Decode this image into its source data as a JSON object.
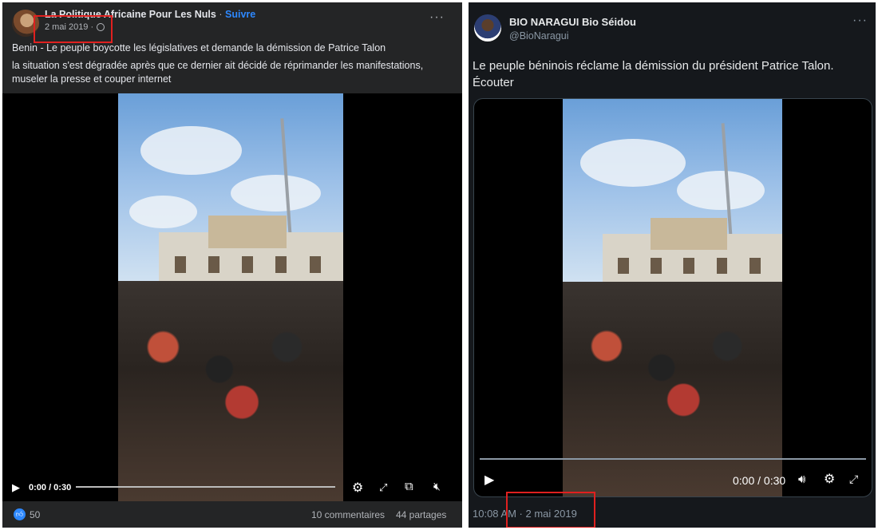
{
  "facebook": {
    "page_name": "La Politique Africaine Pour Les Nuls",
    "separator": "·",
    "follow_label": "Suivre",
    "date": "2 mai 2019 ·",
    "more_label": "···",
    "post_line1": "Benin - Le peuple boycotte les législatives et demande la démission de Patrice Talon",
    "post_line2": "la situation s'est dégradée après que ce dernier ait décidé de réprimander les manifestations, museler la presse et couper internet",
    "video_time": "0:00 / 0:30",
    "video_progress": 0,
    "reactions_count": "50",
    "comments": "10 commentaires",
    "shares": "44 partages"
  },
  "twitter": {
    "display_name": "BIO NARAGUI Bio Séidou",
    "handle": "@BioNaragui",
    "more_label": "···",
    "tweet_text": "Le peuple béninois réclame la démission du président Patrice Talon. Écouter",
    "video_time": "0:00 / 0:30",
    "video_progress": 0,
    "timestamp": "10:08 AM · 2 mai 2019"
  },
  "colors": {
    "highlight_box": "#e0201f",
    "fb_link": "#2d88ff",
    "fb_bg": "#242526",
    "tw_bg": "#15181c"
  }
}
